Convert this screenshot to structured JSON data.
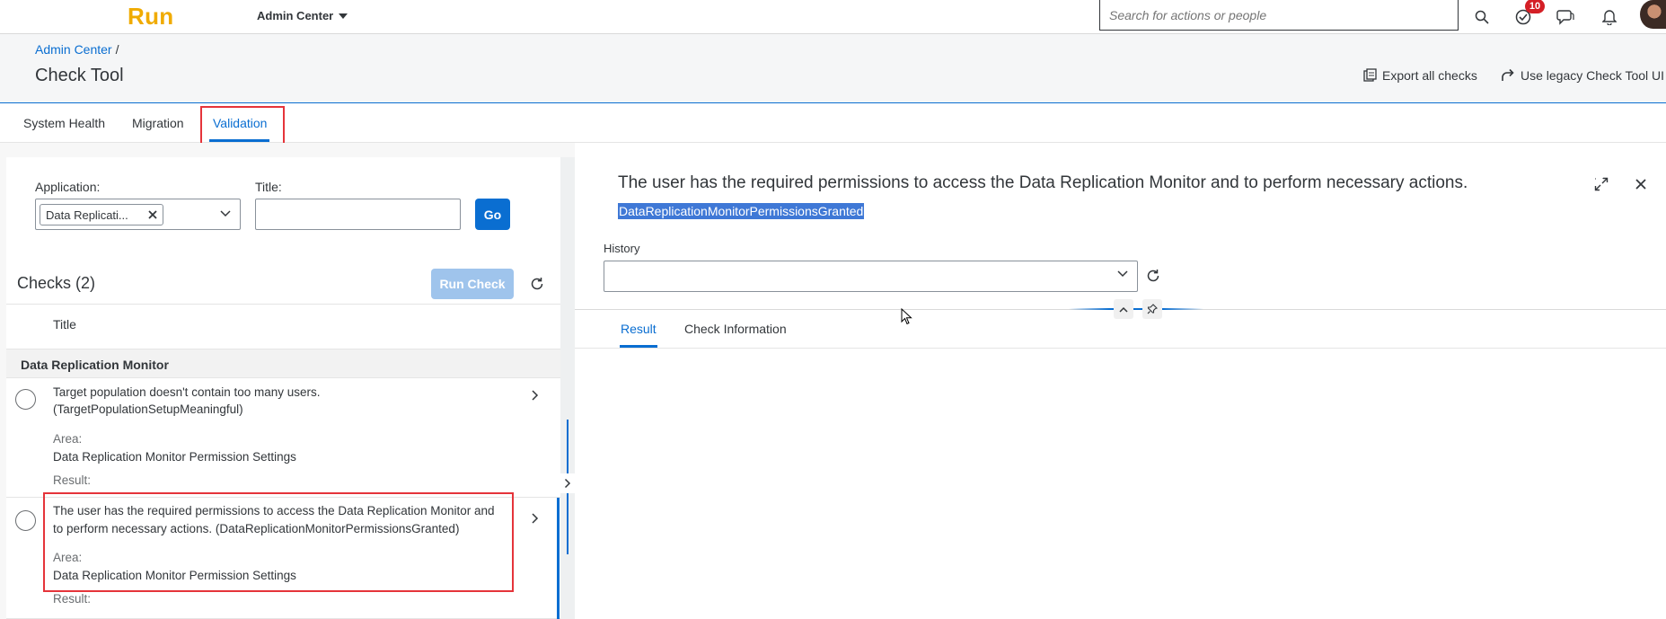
{
  "shell": {
    "logo": "Run",
    "menu_label": "Admin Center",
    "search_placeholder": "Search for actions or people",
    "notifications_count": "10",
    "icons": [
      "search-icon",
      "task-check-icon",
      "feedback-icon",
      "bell-icon",
      "avatar"
    ]
  },
  "header": {
    "breadcrumb": "Admin Center",
    "breadcrumb_sep": "/",
    "title": "Check Tool",
    "export_label": "Export all checks",
    "legacy_label": "Use legacy Check Tool UI"
  },
  "tabs": [
    {
      "label": "System Health"
    },
    {
      "label": "Migration"
    },
    {
      "label": "Validation",
      "active": true
    }
  ],
  "filters": {
    "application_label": "Application:",
    "application_token": "Data Replicati...",
    "title_label": "Title:",
    "title_value": "",
    "go_label": "Go"
  },
  "checks": {
    "heading": "Checks (2)",
    "run_label": "Run Check",
    "column_title": "Title",
    "group": "Data Replication Monitor",
    "items": [
      {
        "line1": "Target population doesn't contain too many users.",
        "line2": "(TargetPopulationSetupMeaningful)",
        "area_label": "Area:",
        "area": "Data Replication Monitor Permission Settings",
        "result_label": "Result:"
      },
      {
        "line1": "The user has the required permissions to access the Data Replication Monitor and",
        "line2": "to perform necessary actions. (DataReplicationMonitorPermissionsGranted)",
        "area_label": "Area:",
        "area": "Data Replication Monitor Permission Settings",
        "result_label": "Result:"
      }
    ]
  },
  "detail": {
    "title": "The user has the required permissions to access the Data Replication Monitor and to perform necessary actions.",
    "technical_name": "DataReplicationMonitorPermissionsGranted",
    "history_label": "History",
    "history_value": "",
    "tabs": [
      {
        "label": "Result",
        "active": true
      },
      {
        "label": "Check Information"
      }
    ]
  },
  "colors": {
    "accent": "#0a6ed1",
    "logo": "#f0ab00",
    "highlight": "#e5343a",
    "badge": "#d41f26"
  }
}
